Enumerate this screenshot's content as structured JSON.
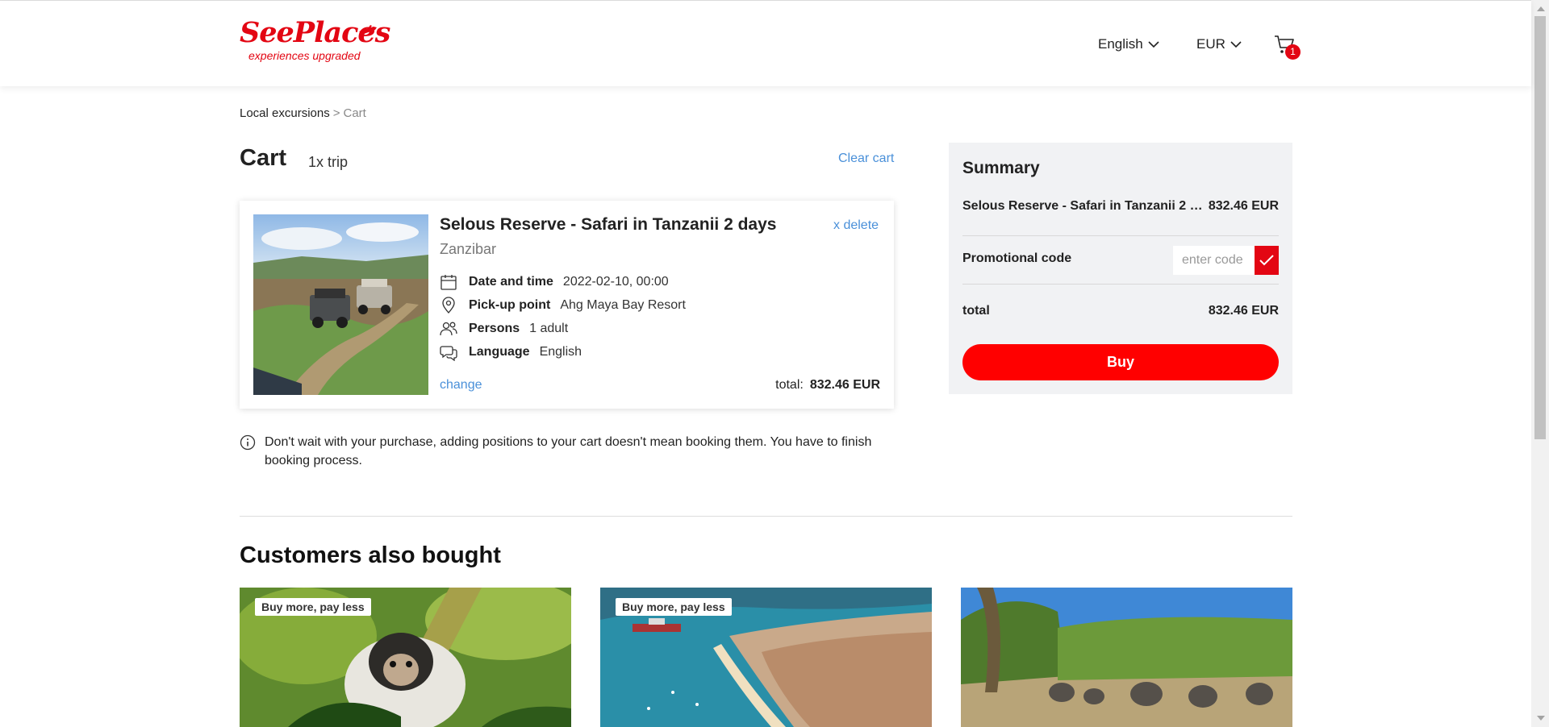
{
  "brand": {
    "name": "SeePlaces",
    "tagline": "experiences upgraded",
    "color": "#e30613"
  },
  "header": {
    "language": "English",
    "currency": "EUR",
    "cart_icon": "cart-icon",
    "cart_count": "1"
  },
  "breadcrumb": {
    "parent": "Local excursions",
    "separator": ">",
    "current": "Cart"
  },
  "cart": {
    "title": "Cart",
    "count_label": "1x trip",
    "clear_label": "Clear cart",
    "item": {
      "title": "Selous Reserve - Safari in Tanzanii 2 days",
      "location": "Zanzibar",
      "delete_label": "x delete",
      "details": [
        {
          "icon": "calendar-icon",
          "label": "Date and time",
          "value": "2022-02-10, 00:00"
        },
        {
          "icon": "location-pin-icon",
          "label": "Pick-up point",
          "value": "Ahg Maya Bay Resort"
        },
        {
          "icon": "persons-icon",
          "label": "Persons",
          "value": "1 adult"
        },
        {
          "icon": "chat-icon",
          "label": "Language",
          "value": "English"
        }
      ],
      "change_label": "change",
      "total_label": "total:",
      "total_value": "832.46 EUR"
    },
    "notice": "Don't wait with your purchase, adding positions to your cart doesn't mean booking them. You have to finish booking process."
  },
  "summary": {
    "title": "Summary",
    "item_name": "Selous Reserve - Safari in Tanzanii 2 days",
    "item_price": "832.46 EUR",
    "promo_label": "Promotional code",
    "promo_placeholder": "enter code",
    "total_label": "total",
    "total_value": "832.46 EUR",
    "buy_label": "Buy",
    "buy_color": "#ff0000"
  },
  "recommendations": {
    "title": "Customers also bought",
    "items": [
      {
        "badge": "Buy more, pay less"
      },
      {
        "badge": "Buy more, pay less"
      },
      {
        "badge": ""
      }
    ]
  },
  "colors": {
    "link": "#4a90d9",
    "accent": "#e30613",
    "summary_bg": "#f1f2f4"
  }
}
